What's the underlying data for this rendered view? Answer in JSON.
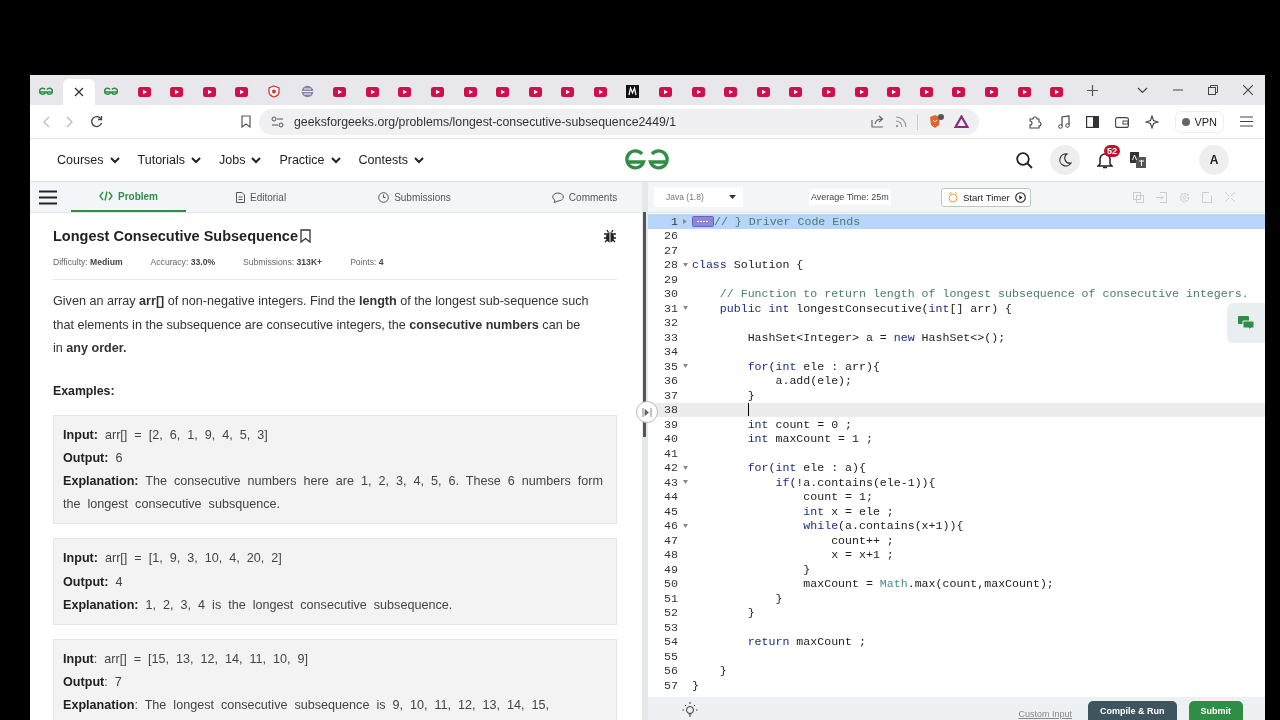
{
  "browser": {
    "tabs": [
      {
        "kind": "gfg",
        "selected": false
      },
      {
        "kind": "blank",
        "selected": true
      },
      {
        "kind": "gfg",
        "selected": false
      },
      {
        "kind": "video",
        "selected": false
      },
      {
        "kind": "video",
        "selected": false
      },
      {
        "kind": "video",
        "selected": false
      },
      {
        "kind": "video",
        "selected": false
      },
      {
        "kind": "shield",
        "selected": false
      },
      {
        "kind": "globe",
        "selected": false
      },
      {
        "kind": "video",
        "selected": false
      },
      {
        "kind": "video",
        "selected": false
      },
      {
        "kind": "video",
        "selected": false
      },
      {
        "kind": "video",
        "selected": false
      },
      {
        "kind": "video",
        "selected": false
      },
      {
        "kind": "video",
        "selected": false
      },
      {
        "kind": "video",
        "selected": false
      },
      {
        "kind": "video",
        "selected": false
      },
      {
        "kind": "video",
        "selected": false
      },
      {
        "kind": "m",
        "selected": false
      },
      {
        "kind": "video",
        "selected": false
      },
      {
        "kind": "video",
        "selected": false
      },
      {
        "kind": "video",
        "selected": false
      },
      {
        "kind": "video",
        "selected": false
      },
      {
        "kind": "video",
        "selected": false
      },
      {
        "kind": "video",
        "selected": false
      },
      {
        "kind": "video",
        "selected": false
      },
      {
        "kind": "video",
        "selected": false
      },
      {
        "kind": "video",
        "selected": false
      },
      {
        "kind": "video",
        "selected": false
      },
      {
        "kind": "video",
        "selected": false
      },
      {
        "kind": "video",
        "selected": false
      },
      {
        "kind": "video",
        "selected": false
      }
    ],
    "url": "geeksforgeeks.org/problems/longest-consecutive-subsequence2449/1",
    "vpn": "VPN"
  },
  "site_nav": {
    "menus": [
      "Courses",
      "Tutorials",
      "Jobs",
      "Practice",
      "Contests"
    ],
    "notifications": "52",
    "avatar": "A"
  },
  "problem_tabs": [
    {
      "label": "Problem",
      "kind": "code",
      "selected": true
    },
    {
      "label": "Editorial",
      "kind": "doc",
      "selected": false
    },
    {
      "label": "Submissions",
      "kind": "clock",
      "selected": false
    },
    {
      "label": "Comments",
      "kind": "comment",
      "selected": false
    }
  ],
  "problem": {
    "title": "Longest Consecutive Subsequence",
    "meta": [
      "Difficulty: **Medium**",
      "Accuracy: **33.0%**",
      "Submissions: **313K+**",
      "Points: **4**"
    ],
    "description": "Given an array **arr[]** of non-negative integers. Find the **length** of the longest sub-sequence such that elements in the subsequence are consecutive integers, the **consecutive numbers** can be in **any order.**",
    "examples_heading": "Examples:",
    "examples": [
      [
        "**Input:** arr[] = [2, 6, 1, 9, 4, 5, 3]",
        "**Output:** 6",
        "**Explanation:** The consecutive numbers here are 1, 2, 3, 4, 5, 6. These 6 numbers form the longest consecutive subsquence."
      ],
      [
        "**Input:** arr[] = [1, 9, 3, 10, 4, 20, 2]",
        "**Output:** 4",
        "**Explanation:** 1, 2, 3, 4 is the longest consecutive subsequence."
      ],
      [
        "**Input**: arr[] = [15, 13, 12, 14, 11, 10, 9]",
        "**Output**: 7",
        "**Explanation**: The longest consecutive subsequence is 9, 10, 11, 12, 13, 14, 15,"
      ]
    ]
  },
  "editor": {
    "language": "Java (1.8)",
    "average_time": "Average Time: 25m",
    "timer_button": "Start Timer",
    "lines": [
      {
        "n": "1",
        "kind": "collapsed",
        "selected": true,
        "current": false,
        "parts": [
          {
            "kind": "comment",
            "text": "// } Driver Code Ends"
          }
        ]
      },
      {
        "n": "26",
        "kind": "plain",
        "selected": false,
        "current": false
      },
      {
        "n": "27",
        "kind": "plain",
        "selected": false,
        "current": false
      },
      {
        "n": "28",
        "kind": "expanded",
        "selected": false,
        "current": false,
        "parts": [
          {
            "kind": "keyword",
            "text": "class"
          },
          {
            "kind": "plain",
            "text": " Solution {"
          }
        ]
      },
      {
        "n": "29",
        "kind": "plain",
        "selected": false,
        "current": false
      },
      {
        "n": "30",
        "kind": "plain",
        "selected": false,
        "current": false,
        "parts": [
          {
            "kind": "comment",
            "text": "    // Function to return length of longest subsequence of consecutive integers."
          }
        ]
      },
      {
        "n": "31",
        "kind": "expanded",
        "selected": false,
        "current": false,
        "parts": [
          {
            "kind": "keyword",
            "text": "    public int"
          },
          {
            "kind": "plain",
            "text": " longestConsecutive("
          },
          {
            "kind": "keyword",
            "text": "int"
          },
          {
            "kind": "plain",
            "text": "[] arr) {"
          }
        ]
      },
      {
        "n": "32",
        "kind": "plain",
        "selected": false,
        "current": false
      },
      {
        "n": "33",
        "kind": "plain",
        "selected": false,
        "current": false,
        "parts": [
          {
            "kind": "plain",
            "text": "        HashSet<Integer> a = "
          },
          {
            "kind": "keyword",
            "text": "new"
          },
          {
            "kind": "plain",
            "text": " HashSet<>();"
          }
        ]
      },
      {
        "n": "34",
        "kind": "plain",
        "selected": false,
        "current": false
      },
      {
        "n": "35",
        "kind": "expanded",
        "selected": false,
        "current": false,
        "parts": [
          {
            "kind": "keyword",
            "text": "        for"
          },
          {
            "kind": "plain",
            "text": "("
          },
          {
            "kind": "keyword",
            "text": "int"
          },
          {
            "kind": "plain",
            "text": " ele : arr){"
          }
        ]
      },
      {
        "n": "36",
        "kind": "plain",
        "selected": false,
        "current": false,
        "parts": [
          {
            "kind": "plain",
            "text": "            a.add(ele);"
          }
        ]
      },
      {
        "n": "37",
        "kind": "plain",
        "selected": false,
        "current": false,
        "parts": [
          {
            "kind": "plain",
            "text": "        }"
          }
        ]
      },
      {
        "n": "38",
        "kind": "plain",
        "selected": false,
        "current": true
      },
      {
        "n": "39",
        "kind": "plain",
        "selected": false,
        "current": false,
        "parts": [
          {
            "kind": "keyword",
            "text": "        int"
          },
          {
            "kind": "plain",
            "text": " count = 0 ;"
          }
        ]
      },
      {
        "n": "40",
        "kind": "plain",
        "selected": false,
        "current": false,
        "parts": [
          {
            "kind": "keyword",
            "text": "        int"
          },
          {
            "kind": "plain",
            "text": " maxCount = 1 ;"
          }
        ]
      },
      {
        "n": "41",
        "kind": "plain",
        "selected": false,
        "current": false
      },
      {
        "n": "42",
        "kind": "expanded",
        "selected": false,
        "current": false,
        "parts": [
          {
            "kind": "keyword",
            "text": "        for"
          },
          {
            "kind": "plain",
            "text": "("
          },
          {
            "kind": "keyword",
            "text": "int"
          },
          {
            "kind": "plain",
            "text": " ele : a){"
          }
        ]
      },
      {
        "n": "43",
        "kind": "expanded",
        "selected": false,
        "current": false,
        "parts": [
          {
            "kind": "keyword",
            "text": "            if"
          },
          {
            "kind": "plain",
            "text": "(!a.contains(ele-1)){"
          }
        ]
      },
      {
        "n": "44",
        "kind": "plain",
        "selected": false,
        "current": false,
        "parts": [
          {
            "kind": "plain",
            "text": "                count = 1;"
          }
        ]
      },
      {
        "n": "45",
        "kind": "plain",
        "selected": false,
        "current": false,
        "parts": [
          {
            "kind": "keyword",
            "text": "                int"
          },
          {
            "kind": "plain",
            "text": " x = ele ;"
          }
        ]
      },
      {
        "n": "46",
        "kind": "expanded",
        "selected": false,
        "current": false,
        "parts": [
          {
            "kind": "keyword",
            "text": "                while"
          },
          {
            "kind": "plain",
            "text": "(a.contains(x+1)){"
          }
        ]
      },
      {
        "n": "47",
        "kind": "plain",
        "selected": false,
        "current": false,
        "parts": [
          {
            "kind": "plain",
            "text": "                    count++ ;"
          }
        ]
      },
      {
        "n": "48",
        "kind": "plain",
        "selected": false,
        "current": false,
        "parts": [
          {
            "kind": "plain",
            "text": "                    x = x+1 ;"
          }
        ]
      },
      {
        "n": "49",
        "kind": "plain",
        "selected": false,
        "current": false,
        "parts": [
          {
            "kind": "plain",
            "text": "                }"
          }
        ]
      },
      {
        "n": "50",
        "kind": "plain",
        "selected": false,
        "current": false,
        "parts": [
          {
            "kind": "plain",
            "text": "                maxCount = "
          },
          {
            "kind": "class",
            "text": "Math"
          },
          {
            "kind": "plain",
            "text": ".max(count,maxCount);"
          }
        ]
      },
      {
        "n": "51",
        "kind": "plain",
        "selected": false,
        "current": false,
        "parts": [
          {
            "kind": "plain",
            "text": "            }"
          }
        ]
      },
      {
        "n": "52",
        "kind": "plain",
        "selected": false,
        "current": false,
        "parts": [
          {
            "kind": "plain",
            "text": "        }"
          }
        ]
      },
      {
        "n": "53",
        "kind": "plain",
        "selected": false,
        "current": false
      },
      {
        "n": "54",
        "kind": "plain",
        "selected": false,
        "current": false,
        "parts": [
          {
            "kind": "keyword",
            "text": "        return"
          },
          {
            "kind": "plain",
            "text": " maxCount ;"
          }
        ]
      },
      {
        "n": "55",
        "kind": "plain",
        "selected": false,
        "current": false
      },
      {
        "n": "56",
        "kind": "plain",
        "selected": false,
        "current": false,
        "parts": [
          {
            "kind": "plain",
            "text": "    }"
          }
        ]
      },
      {
        "n": "57",
        "kind": "plain",
        "selected": false,
        "current": false,
        "parts": [
          {
            "kind": "plain",
            "text": "}"
          }
        ]
      }
    ],
    "custom_input": "Custom Input",
    "compile_button": "Compile & Run",
    "submit_button": "Submit"
  }
}
